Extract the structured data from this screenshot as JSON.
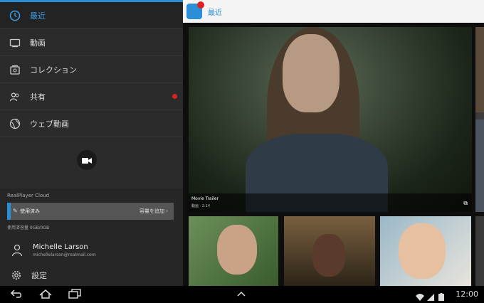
{
  "drawer": {
    "items": [
      {
        "label": "最近",
        "icon": "clock-icon",
        "active": true
      },
      {
        "label": "動画",
        "icon": "video-frame-icon",
        "active": false
      },
      {
        "label": "コレクション",
        "icon": "collection-icon",
        "active": false
      },
      {
        "label": "共有",
        "icon": "people-icon",
        "active": false,
        "badge": true
      },
      {
        "label": "ウェブ動画",
        "icon": "globe-icon",
        "active": false
      }
    ],
    "cloud": {
      "title": "RealPlayer Cloud",
      "usage_label": "使用済み",
      "usage_action": "容量を追加",
      "usage_text": "使用済容量 0GB/0GB",
      "usage_fraction": 0.02
    },
    "account": {
      "name": "Michelle Larson",
      "email": "michellelarson@realmail.com"
    },
    "settings_label": "設定"
  },
  "main": {
    "title": "最近",
    "hero": {
      "caption_title": "Movie Trailer",
      "caption_meta": "動画 · 2:14",
      "action_icon": "play-icon"
    }
  },
  "system": {
    "clock": "12:00"
  },
  "colors": {
    "accent": "#2a8fd6",
    "badge": "#e02020",
    "drawer_bg": "#2b2b2b"
  }
}
